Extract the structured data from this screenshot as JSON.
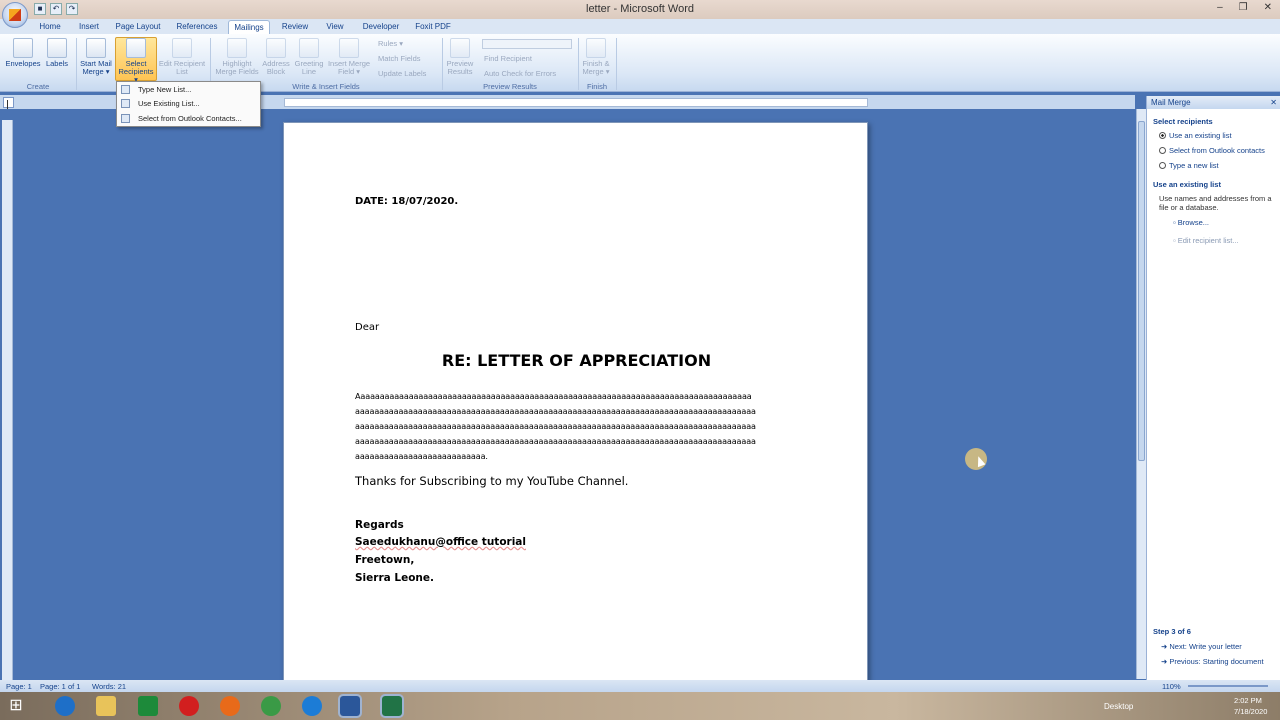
{
  "window": {
    "title": "letter - Microsoft Word"
  },
  "tabs": [
    "Home",
    "Insert",
    "Page Layout",
    "References",
    "Mailings",
    "Review",
    "View",
    "Developer",
    "Foxit PDF"
  ],
  "active_tab": "Mailings",
  "ribbon": {
    "envelopes": "Envelopes",
    "labels": "Labels",
    "start_mail_merge": "Start Mail Merge ▾",
    "select_recipients": "Select Recipients ▾",
    "edit_recipient_list": "Edit Recipient List",
    "highlight_merge_fields": "Highlight Merge Fields",
    "address_block": "Address Block",
    "greeting_line": "Greeting Line",
    "insert_merge_field": "Insert Merge Field ▾",
    "rules": "Rules ▾",
    "match_fields": "Match Fields",
    "update_labels": "Update Labels",
    "preview_results": "Preview Results",
    "find_recipient": "Find Recipient",
    "auto_check": "Auto Check for Errors",
    "finish_merge": "Finish & Merge ▾",
    "groups": {
      "create": "Create",
      "write_insert": "Write & Insert Fields",
      "preview": "Preview Results",
      "finish": "Finish"
    }
  },
  "dropdown": {
    "items": [
      "Type New List...",
      "Use Existing List...",
      "Select from Outlook Contacts..."
    ]
  },
  "document": {
    "date": "DATE: 18/07/2020.",
    "dear": "Dear",
    "heading": "RE: LETTER OF APPRECIATION",
    "body_lines": [
      "Aaaaaaaaaaaaaaaaaaaaaaaaaaaaaaaaaaaaaaaaaaaaaaaaaaaaaaaaaaaaaaaaaaaaaaaaaaaaaaaaaa",
      "aaaaaaaaaaaaaaaaaaaaaaaaaaaaaaaaaaaaaaaaaaaaaaaaaaaaaaaaaaaaaaaaaaaaaaaaaaaaaaaaaaa",
      "aaaaaaaaaaaaaaaaaaaaaaaaaaaaaaaaaaaaaaaaaaaaaaaaaaaaaaaaaaaaaaaaaaaaaaaaaaaaaaaaaaa",
      "aaaaaaaaaaaaaaaaaaaaaaaaaaaaaaaaaaaaaaaaaaaaaaaaaaaaaaaaaaaaaaaaaaaaaaaaaaaaaaaaaaa",
      "aaaaaaaaaaaaaaaaaaaaaaaaaaa."
    ],
    "thanks": "Thanks for Subscribing to my YouTube Channel.",
    "regards": "Regards",
    "sig1": "Saeedukhanu@office tutorial",
    "sig2": "Freetown,",
    "sig3": "Sierra Leone."
  },
  "pane": {
    "title": "Mail Merge",
    "select_recipients": "Select recipients",
    "opt1": "Use an existing list",
    "opt2": "Select from Outlook contacts",
    "opt3": "Type a new list",
    "section": "Use an existing list",
    "desc1": "Use names and addresses from a",
    "desc2": "file or a database.",
    "browse": "Browse...",
    "edit": "Edit recipient list...",
    "step": "Step 3 of 6",
    "next": "Next: Write your letter",
    "prev": "Previous: Starting document"
  },
  "status": {
    "page": "Page: 1",
    "pages": "Page: 1 of 1",
    "words": "Words: 21",
    "zoom": "110%"
  },
  "tray": {
    "desktop": "Desktop",
    "time": "2:02 PM",
    "date": "7/18/2020"
  }
}
